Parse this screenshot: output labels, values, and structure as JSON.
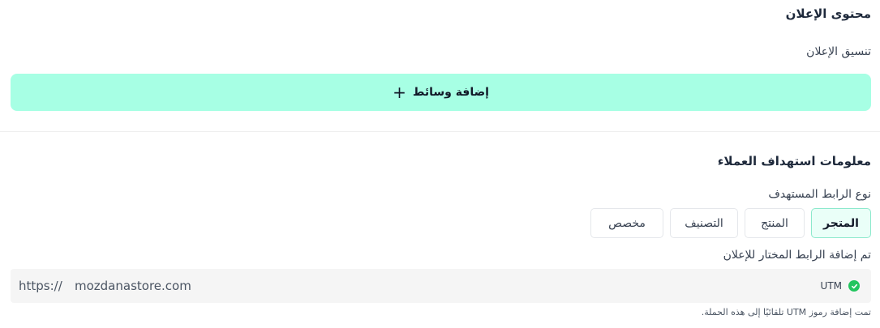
{
  "ad_content": {
    "title": "محتوى الإعلان",
    "format_label": "تنسيق الإعلان",
    "add_media_label": "إضافة وسائط"
  },
  "targeting": {
    "title": "معلومات استهداف العملاء",
    "link_type_label": "نوع الرابط المستهدف",
    "tabs": [
      {
        "label": "المتجر",
        "active": true
      },
      {
        "label": "المنتج",
        "active": false
      },
      {
        "label": "التصنيف",
        "active": false
      },
      {
        "label": "مخصص",
        "active": false
      }
    ],
    "selected_link_label": "تم إضافة الرابط المختار للإعلان",
    "url_scheme": "https://",
    "url_domain": "mozdanastore.com",
    "utm_label": "UTM",
    "utm_note": "تمت إضافة رموز UTM تلقائيًا إلى هذه الحملة."
  },
  "colors": {
    "accent": "#a7ffe4",
    "success": "#22c55e"
  }
}
